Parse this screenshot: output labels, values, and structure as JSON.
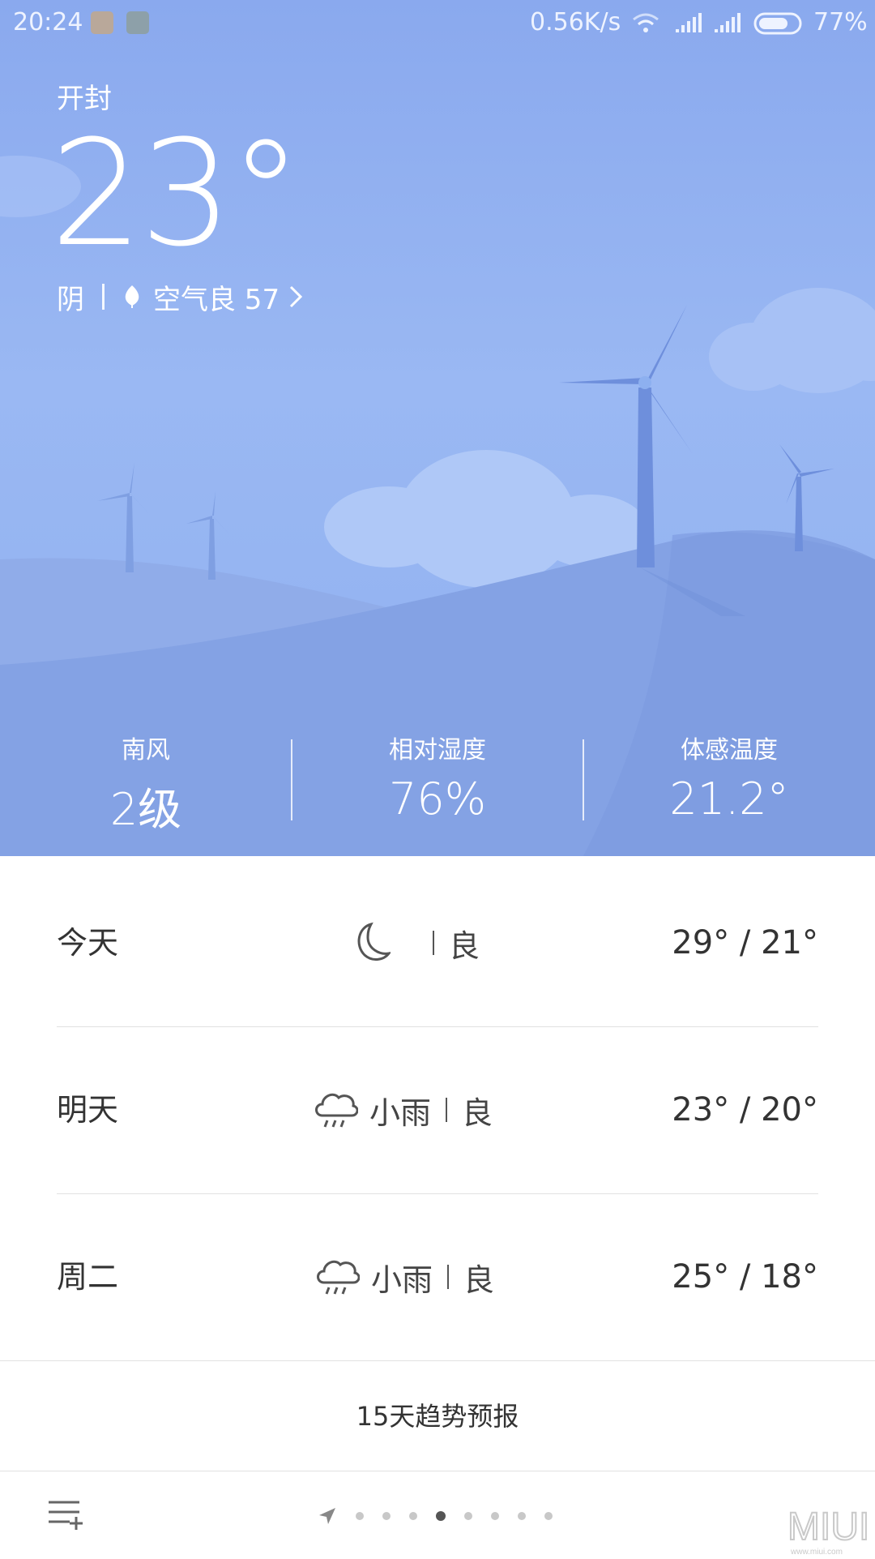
{
  "status_bar": {
    "time": "20:24",
    "net_speed": "0.56K/s",
    "battery_pct": "77%",
    "battery_level": 0.77,
    "icons": [
      "shield-icon",
      "note-icon",
      "wifi-icon",
      "signal-icon",
      "signal-icon",
      "battery-icon"
    ]
  },
  "weather": {
    "city": "开封",
    "temperature": "23°",
    "condition": "阴",
    "air_quality": "空气良 57"
  },
  "stats": [
    {
      "label": "南风",
      "value": "2级"
    },
    {
      "label": "相对湿度",
      "value": "76%"
    },
    {
      "label": "体感温度",
      "value": "21.2°"
    }
  ],
  "forecast": [
    {
      "day": "今天",
      "icon": "moon-icon",
      "condition": "",
      "aqi": "良",
      "temps": "29° / 21°"
    },
    {
      "day": "明天",
      "icon": "cloud-rain-icon",
      "condition": "小雨",
      "aqi": "良",
      "temps": "23° / 20°"
    },
    {
      "day": "周二",
      "icon": "cloud-rain-icon",
      "condition": "小雨",
      "aqi": "良",
      "temps": "25° / 18°"
    }
  ],
  "trend_link": "15天趋势预报",
  "bottom": {
    "page_count": 8,
    "active_page": 4,
    "watermark": "MIUI",
    "watermark_sub": "www.miui.com"
  },
  "colors": {
    "sky_top": "#8aa9ee",
    "sky_bottom": "#8fb0f0",
    "hill_back": "#8ea9e8",
    "hill_front": "#7f9fe2",
    "turbine": "#6f8fdb"
  }
}
